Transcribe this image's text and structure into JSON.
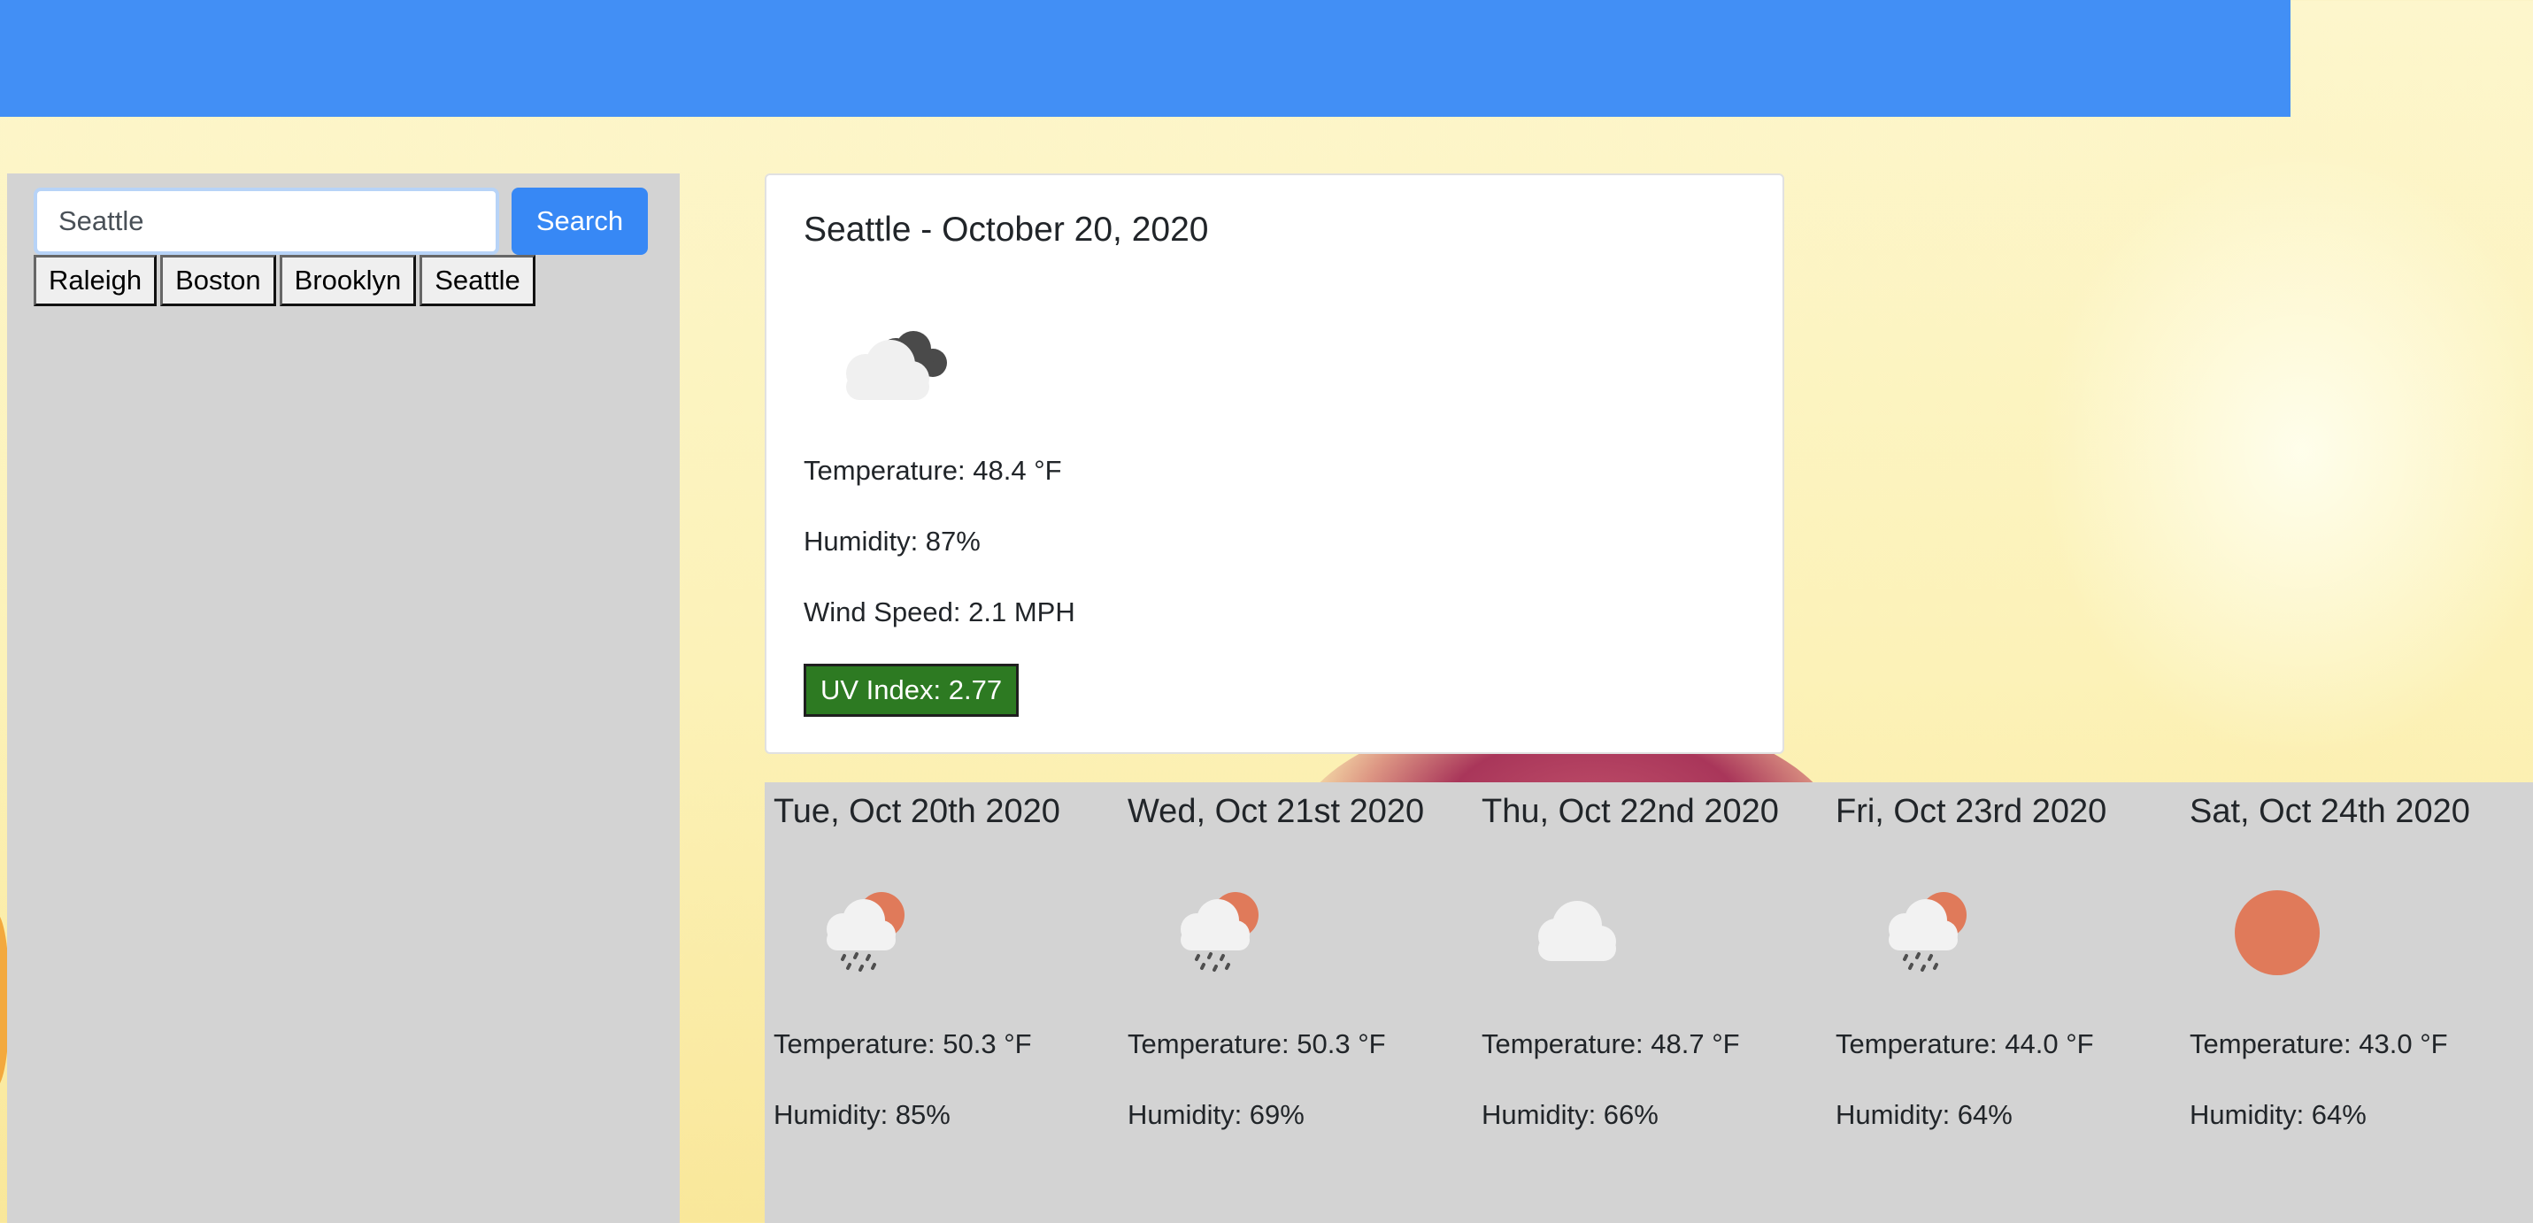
{
  "search": {
    "value": "Seattle",
    "button_label": "Search"
  },
  "history": [
    "Raleigh",
    "Boston",
    "Brooklyn",
    "Seattle"
  ],
  "current": {
    "title": "Seattle - October 20, 2020",
    "icon": "cloudy-night-icon",
    "temperature": "Temperature: 48.4 °F",
    "humidity": "Humidity: 87%",
    "wind": "Wind Speed: 2.1 MPH",
    "uv": "UV Index: 2.77",
    "uv_color": "#2d7a22"
  },
  "forecast": [
    {
      "date": "Tue, Oct 20th 2020",
      "icon": "rain-sun-icon",
      "temperature": "Temperature: 50.3 °F",
      "humidity": "Humidity: 85%"
    },
    {
      "date": "Wed, Oct 21st 2020",
      "icon": "rain-sun-icon",
      "temperature": "Temperature: 50.3 °F",
      "humidity": "Humidity: 69%"
    },
    {
      "date": "Thu, Oct 22nd 2020",
      "icon": "cloud-icon",
      "temperature": "Temperature: 48.7 °F",
      "humidity": "Humidity: 66%"
    },
    {
      "date": "Fri, Oct 23rd 2020",
      "icon": "rain-sun-icon",
      "temperature": "Temperature: 44.0 °F",
      "humidity": "Humidity: 64%"
    },
    {
      "date": "Sat, Oct 24th 2020",
      "icon": "sun-icon",
      "temperature": "Temperature: 43.0 °F",
      "humidity": "Humidity: 64%"
    }
  ],
  "colors": {
    "header": "#428ff5",
    "accent": "#3788f5",
    "panel": "#d3d3d3",
    "sun": "#e07a5a"
  }
}
